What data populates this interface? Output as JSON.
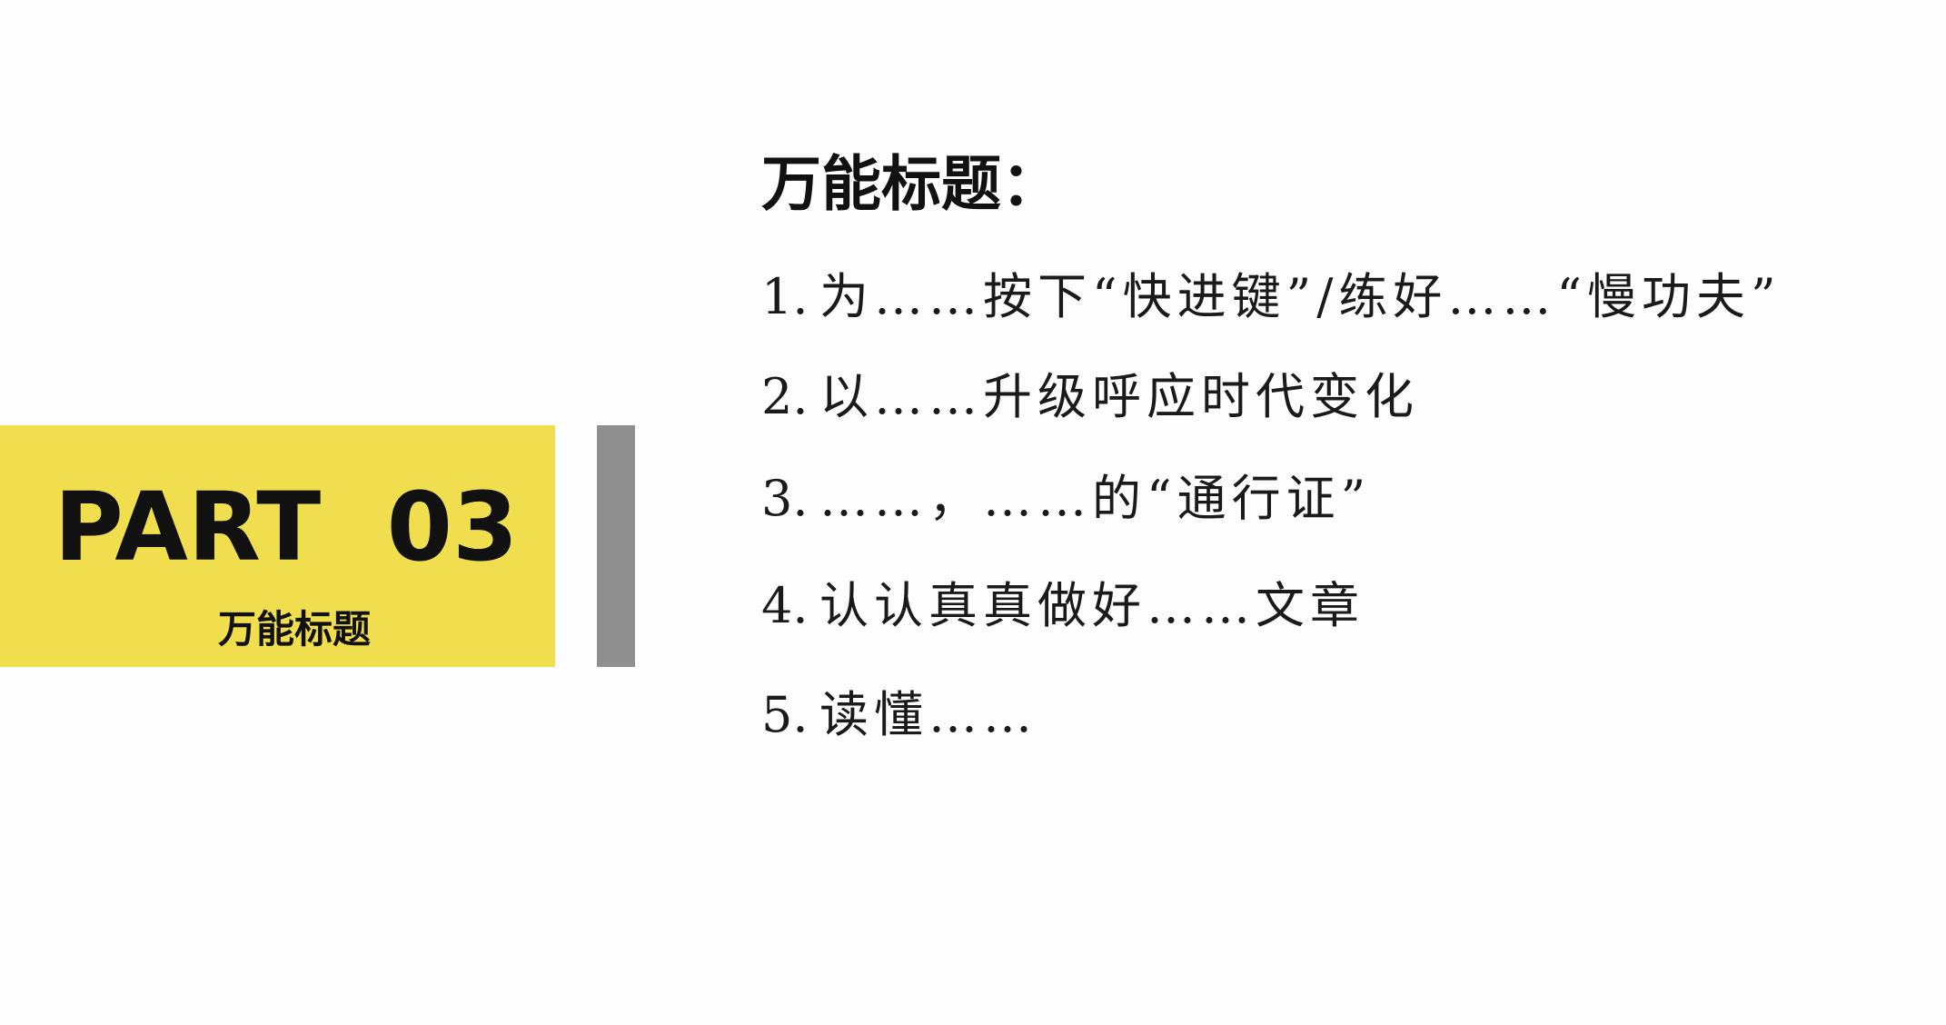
{
  "part_block": {
    "number_label": "PART  03",
    "subtitle": "万能标题"
  },
  "content": {
    "heading": "万能标题：",
    "items": [
      {
        "number": "1.",
        "text": "为……按下“快进键”/练好……“慢功夫”"
      },
      {
        "number": "2.",
        "text": "以……升级呼应时代变化"
      },
      {
        "number": "3.",
        "text": "……，……的“通行证”"
      },
      {
        "number": "4.",
        "text": "认认真真做好……文章"
      },
      {
        "number": "5.",
        "text": "读懂……"
      }
    ]
  },
  "colors": {
    "background": "#fdfdfd",
    "accent_yellow": "#f0de4e",
    "divider_gray": "#8f8f8f",
    "text": "#111111"
  }
}
